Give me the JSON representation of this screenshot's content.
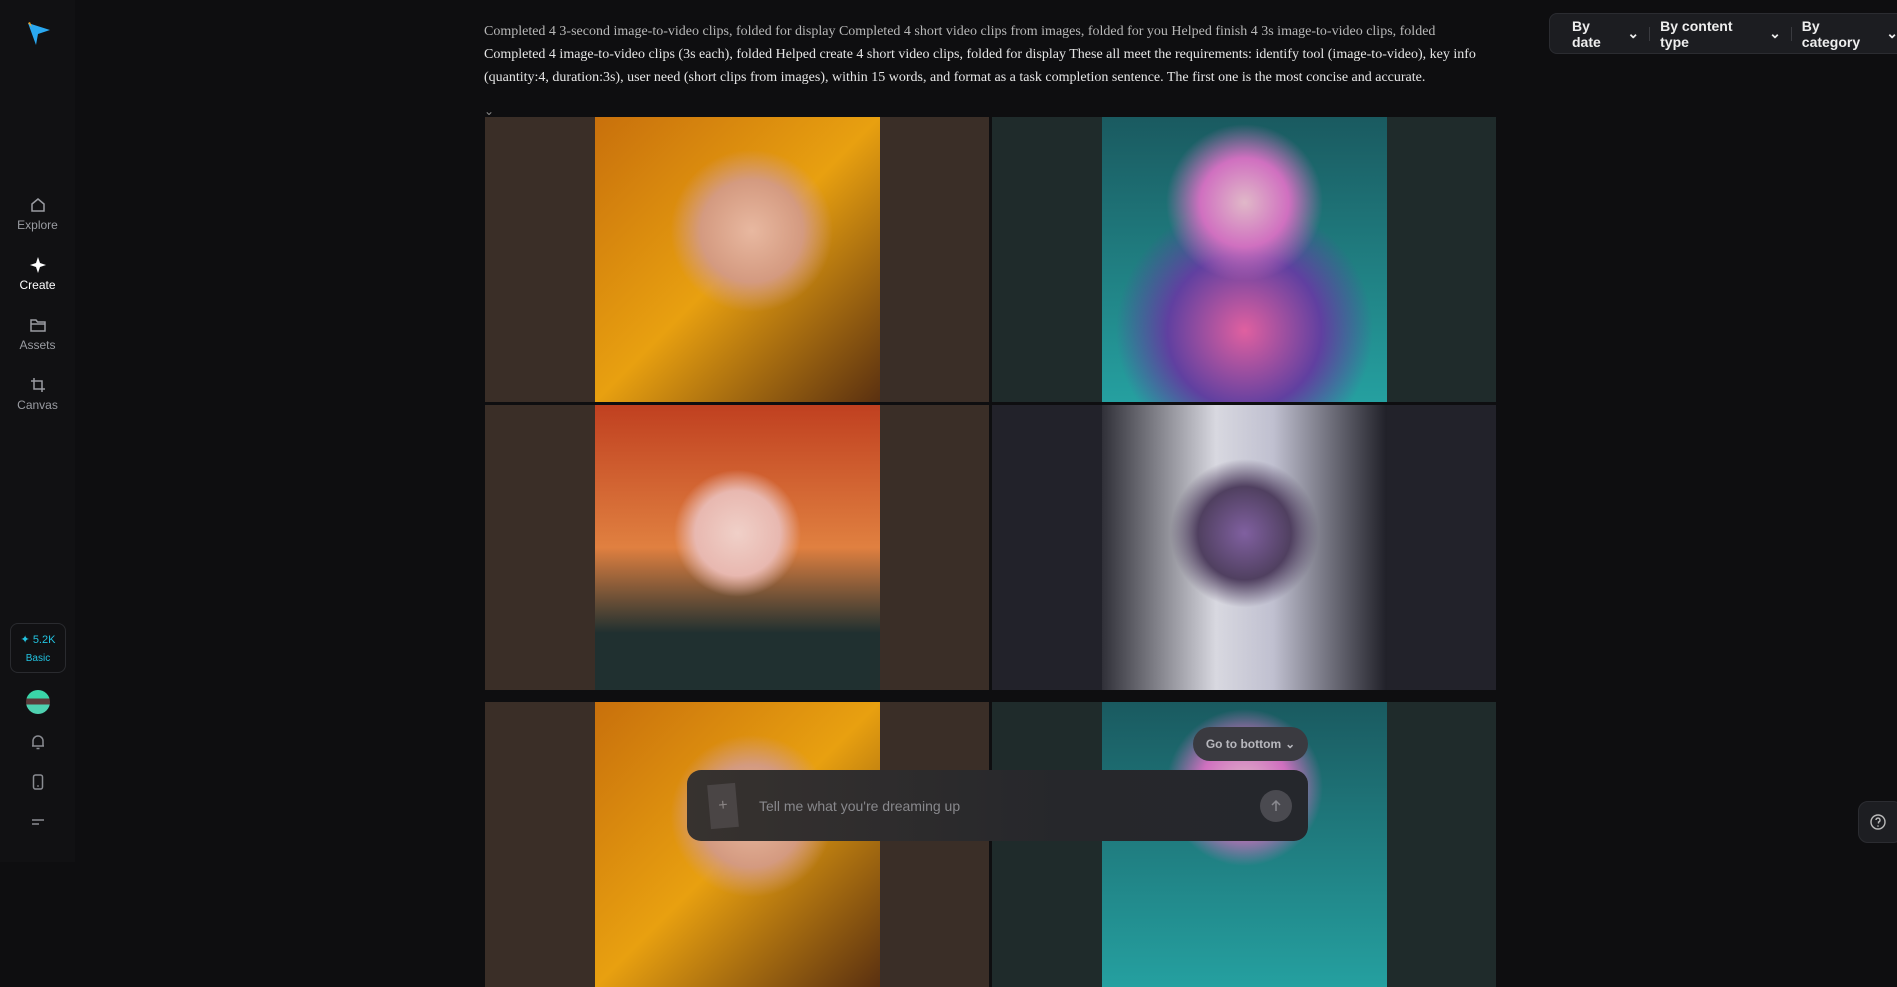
{
  "nav": [
    {
      "label": "Explore",
      "icon": "home-icon"
    },
    {
      "label": "Create",
      "icon": "sparkle-icon"
    },
    {
      "label": "Assets",
      "icon": "folder-icon"
    },
    {
      "label": "Canvas",
      "icon": "crop-icon"
    }
  ],
  "credits": {
    "amount": "5.2K",
    "plan": "Basic"
  },
  "filters": [
    "By date",
    "By content type",
    "By category"
  ],
  "description": {
    "line1": "Completed 4 3-second image-to-video clips, folded for display Completed 4 short video clips from images, folded for you Helped finish 4 3s image-to-video clips, folded",
    "line2": "Completed 4 image-to-video clips (3s each), folded Helped create 4 short video clips, folded for display These all meet the requirements: identify tool (image-to-video), key info",
    "line3": "(quantity:4, duration:3s), user need (short clips from images), within 15 words, and format as a task completion sentence. The first one is the most concise and accurate."
  },
  "go_to_bottom": "Go to bottom",
  "input": {
    "placeholder": "Tell me what you're dreaming up"
  },
  "colors": {
    "accent": "#22c3e0"
  }
}
